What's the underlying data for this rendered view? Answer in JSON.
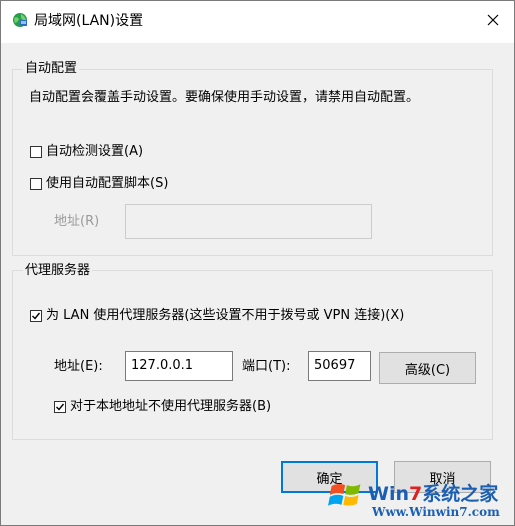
{
  "window": {
    "title": "局域网(LAN)设置",
    "icon": "network-globe-icon",
    "close_icon": "close-icon"
  },
  "auto_config": {
    "legend": "自动配置",
    "description": "自动配置会覆盖手动设置。要确保使用手动设置，请禁用自动配置。",
    "auto_detect": {
      "label": "自动检测设置(A)",
      "checked": false
    },
    "auto_script": {
      "label": "使用自动配置脚本(S)",
      "checked": false
    },
    "address_label": "地址(R)",
    "address_value": ""
  },
  "proxy": {
    "legend": "代理服务器",
    "use_proxy": {
      "label": "为 LAN 使用代理服务器(这些设置不用于拨号或 VPN 连接)(X)",
      "checked": true
    },
    "address_label": "地址(E):",
    "address_value": "127.0.0.1",
    "port_label": "端口(T):",
    "port_value": "50697",
    "advanced_label": "高级(C)",
    "bypass_local": {
      "label": "对于本地地址不使用代理服务器(B)",
      "checked": true
    }
  },
  "buttons": {
    "ok": "确定",
    "cancel": "取消"
  },
  "watermark": {
    "brand_a": "Win",
    "brand_num": "7",
    "brand_b": "系统之家",
    "url": "Www.Winwin7.com"
  },
  "colors": {
    "accent": "#0078d7",
    "watermark_blue": "#1a5fb4",
    "watermark_red": "#e02020"
  }
}
